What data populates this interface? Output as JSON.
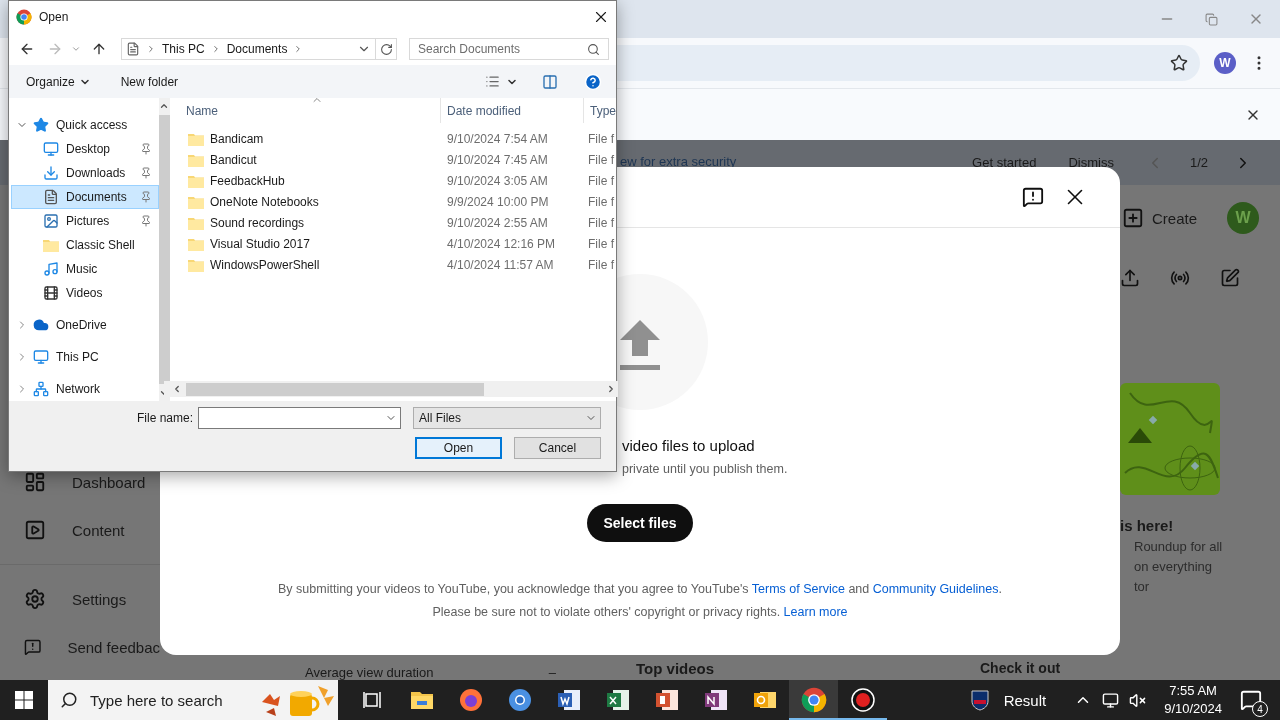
{
  "browser": {
    "profile_initial": "W"
  },
  "banner": {
    "text": "ew for extra security",
    "actions": [
      "Get started",
      "Dismiss"
    ],
    "pager": "1/2"
  },
  "studio": {
    "sidebar": [
      "Dashboard",
      "Content",
      "Settings",
      "Send feedbac"
    ],
    "create": "Create",
    "avatar": "W",
    "promo": {
      "kind": "picture",
      "title": "is here!",
      "lines": [
        "Roundup for all",
        "on everything",
        "tor"
      ]
    },
    "analytics": {
      "metric": "Average view duration",
      "metric_value": "–",
      "top_videos": "Top videos",
      "link": "Check it out"
    }
  },
  "upload": {
    "prompt": "video files to upload",
    "note": "private until you publish them.",
    "button": "Select files",
    "terms": [
      {
        "text": "By submitting your videos to YouTube, you acknowledge that you agree to YouTube's ",
        "link": false
      },
      {
        "text": "Terms of Service",
        "link": true
      },
      {
        "text": " and ",
        "link": false
      },
      {
        "text": "Community Guidelines",
        "link": true
      },
      {
        "text": ".",
        "link": false
      }
    ],
    "notice": [
      {
        "text": "Please be sure not to violate others' copyright or privacy rights. ",
        "link": false
      },
      {
        "text": "Learn more",
        "link": true
      }
    ]
  },
  "file_dialog": {
    "title": "Open",
    "path": [
      "This PC",
      "Documents"
    ],
    "search": {
      "placeholder": "Search Documents"
    },
    "commands": [
      {
        "label": "Organize",
        "menu": true
      },
      {
        "label": "New folder",
        "menu": false
      }
    ],
    "tree": [
      {
        "label": "Quick access",
        "expanded": true,
        "selected": false,
        "children": [
          {
            "label": "Desktop",
            "pinned": true,
            "selected": false
          },
          {
            "label": "Downloads",
            "pinned": true,
            "selected": false
          },
          {
            "label": "Documents",
            "pinned": true,
            "selected": true
          },
          {
            "label": "Pictures",
            "pinned": true,
            "selected": false
          },
          {
            "label": "Classic Shell",
            "pinned": false,
            "selected": false
          },
          {
            "label": "Music",
            "pinned": false,
            "selected": false
          },
          {
            "label": "Videos",
            "pinned": false,
            "selected": false
          }
        ]
      },
      {
        "label": "OneDrive",
        "expanded": false,
        "selected": false
      },
      {
        "label": "This PC",
        "expanded": false,
        "selected": false
      },
      {
        "label": "Network",
        "expanded": false,
        "selected": false
      }
    ],
    "columns": [
      "Name",
      "Date modified",
      "Type"
    ],
    "files": [
      {
        "name": "Bandicam",
        "date": "9/10/2024 7:54 AM",
        "type": "File f"
      },
      {
        "name": "Bandicut",
        "date": "9/10/2024 7:45 AM",
        "type": "File f"
      },
      {
        "name": "FeedbackHub",
        "date": "9/10/2024 3:05 AM",
        "type": "File f"
      },
      {
        "name": "OneNote Notebooks",
        "date": "9/9/2024 10:00 PM",
        "type": "File f"
      },
      {
        "name": "Sound recordings",
        "date": "9/10/2024 2:55 AM",
        "type": "File f"
      },
      {
        "name": "Visual Studio 2017",
        "date": "4/10/2024 12:16 PM",
        "type": "File f"
      },
      {
        "name": "WindowsPowerShell",
        "date": "4/10/2024 11:57 AM",
        "type": "File f"
      }
    ],
    "file_name_label": "File name:",
    "filter": "All Files",
    "buttons": [
      {
        "label": "Open",
        "default": true
      },
      {
        "label": "Cancel",
        "default": false
      }
    ]
  },
  "taskbar": {
    "search": {
      "placeholder": "Type here to search"
    },
    "apps": [
      {
        "running": false,
        "selected": false
      },
      {
        "running": false,
        "selected": false
      },
      {
        "running": false,
        "selected": false
      },
      {
        "running": false,
        "selected": false
      },
      {
        "running": false,
        "selected": false
      },
      {
        "running": false,
        "selected": false
      },
      {
        "running": false,
        "selected": false
      },
      {
        "running": false,
        "selected": false
      },
      {
        "running": true,
        "selected": true
      },
      {
        "running": true,
        "selected": false
      }
    ],
    "weather": "Result",
    "time": "7:55 AM",
    "date": "9/10/2024",
    "notifications": "4"
  }
}
